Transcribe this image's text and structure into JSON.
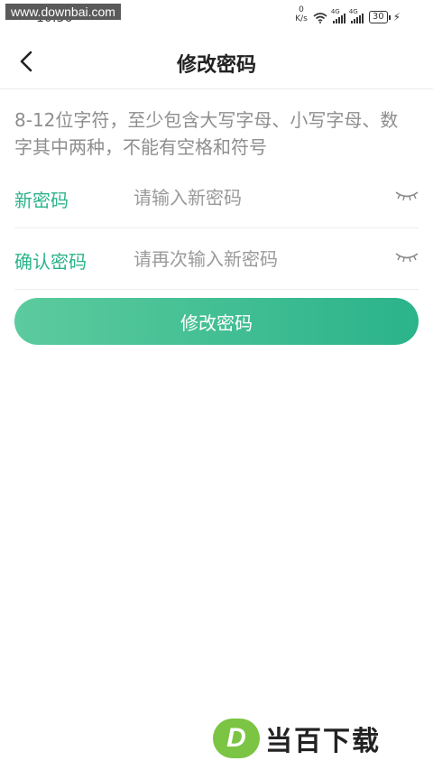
{
  "status_bar": {
    "watermark": "www.downbai.com",
    "time": "10:36",
    "speed_value": "0",
    "speed_unit": "K/s",
    "net_tag_1": "4G",
    "net_tag_2": "4G",
    "battery": "30"
  },
  "header": {
    "title": "修改密码"
  },
  "hint": "8-12位字符，至少包含大写字母、小写字母、数字其中两种，不能有空格和符号",
  "fields": [
    {
      "label": "新密码",
      "placeholder": "请输入新密码"
    },
    {
      "label": "确认密码",
      "placeholder": "请再次输入新密码"
    }
  ],
  "submit_label": "修改密码",
  "logo": {
    "mark": "D",
    "text": "当百下载"
  },
  "colors": {
    "accent": "#2bb38a",
    "gradient_start": "#5ccb9e",
    "logo_green": "#7cc443"
  }
}
